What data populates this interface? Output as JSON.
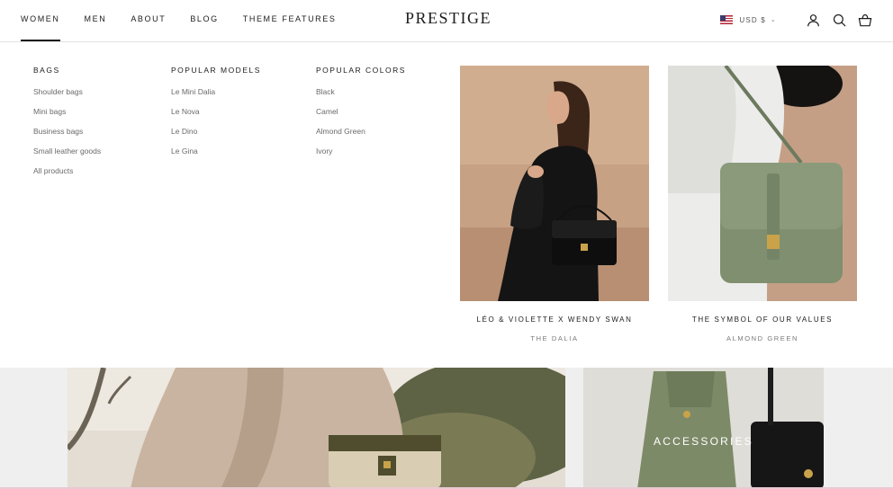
{
  "header": {
    "nav": [
      "WOMEN",
      "MEN",
      "ABOUT",
      "BLOG",
      "THEME FEATURES"
    ],
    "logo": "PRESTIGE",
    "currency": "USD $",
    "icons": [
      "account-icon",
      "search-icon",
      "cart-icon"
    ]
  },
  "menu": {
    "columns": [
      {
        "title": "BAGS",
        "links": [
          "Shoulder bags",
          "Mini bags",
          "Business bags",
          "Small leather goods",
          "All products"
        ]
      },
      {
        "title": "POPULAR MODELS",
        "links": [
          "Le Mini Dalia",
          "Le Nova",
          "Le Dino",
          "Le Gina"
        ]
      },
      {
        "title": "POPULAR COLORS",
        "links": [
          "Black",
          "Camel",
          "Almond Green",
          "Ivory"
        ]
      }
    ],
    "promos": [
      {
        "title": "LÉO & VIOLETTE X WENDY SWAN",
        "subtitle": "THE DALIA"
      },
      {
        "title": "THE SYMBOL OF OUR VALUES",
        "subtitle": "ALMOND GREEN"
      }
    ]
  },
  "below": {
    "tile_right_label": "ACCESSORIES"
  },
  "colors": {
    "text": "#1c1c1c",
    "muted": "#6a6a6a",
    "divider": "#e2e2e2",
    "accent_line": "#e9c9d3"
  }
}
